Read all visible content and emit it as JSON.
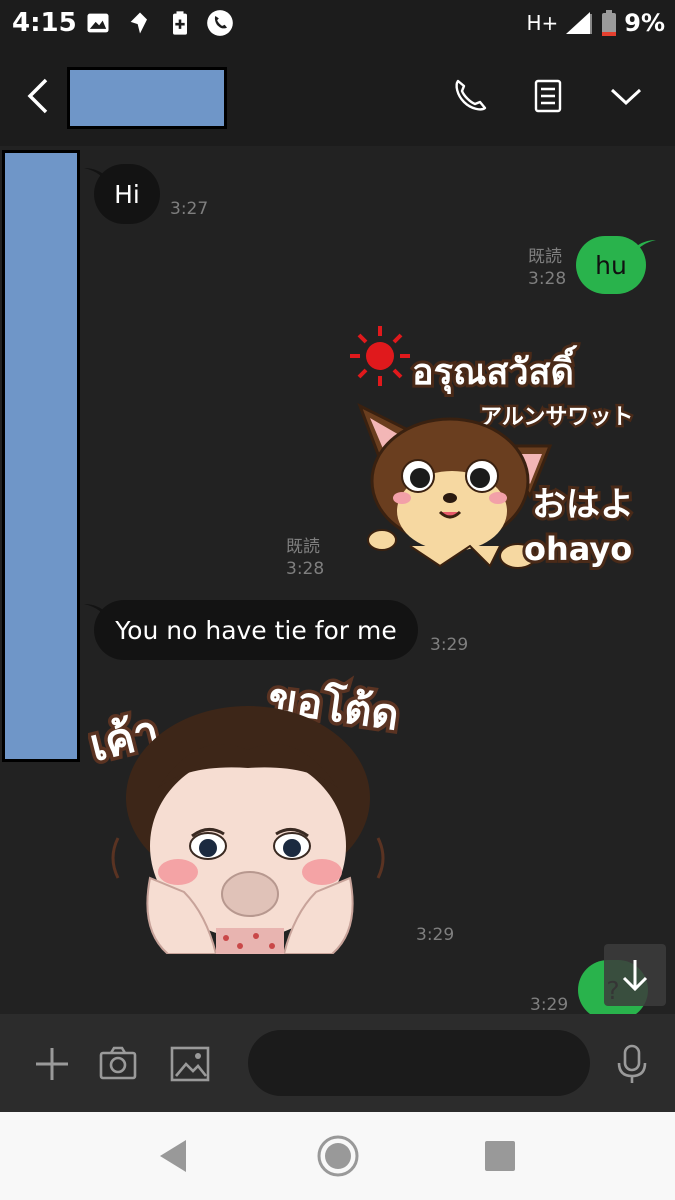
{
  "status_bar": {
    "time": "4:15",
    "network": "H+",
    "battery": "9%",
    "icons": [
      "image-icon",
      "location-icon",
      "battery-plus-icon",
      "phone-call-icon",
      "signal-icon",
      "battery-icon"
    ]
  },
  "header": {
    "contact_name": "",
    "buttons": [
      "back-icon",
      "call-icon",
      "notes-icon",
      "chevron-down-icon"
    ]
  },
  "messages": [
    {
      "dir": "in",
      "type": "text",
      "text": "Hi",
      "time": "3:27"
    },
    {
      "dir": "out",
      "type": "text",
      "text": "hu",
      "read": "既読",
      "time": "3:28"
    },
    {
      "dir": "out",
      "type": "sticker",
      "read": "既読",
      "time": "3:28",
      "sticker_text": [
        "อรุณสวัสดิ์",
        "アルンサワット",
        "おはよ",
        "ohayo"
      ]
    },
    {
      "dir": "in",
      "type": "text",
      "text": "You no have tie for me",
      "time": "3:29"
    },
    {
      "dir": "in",
      "type": "sticker",
      "time": "3:29",
      "sticker_text": [
        "เค้า",
        "ขอโต้ด"
      ]
    },
    {
      "dir": "out",
      "type": "text",
      "text": "?",
      "time": "3:29"
    }
  ],
  "input_bar": {
    "placeholder": "",
    "icons": [
      "plus-icon",
      "camera-icon",
      "gallery-icon",
      "emoji-icon",
      "mic-icon"
    ]
  },
  "colors": {
    "chat_bg": "#222222",
    "bar_bg": "#1c1c1c",
    "incoming_bubble": "#131313",
    "outgoing_bubble": "#29b34c",
    "redaction": "#6f96c8"
  }
}
